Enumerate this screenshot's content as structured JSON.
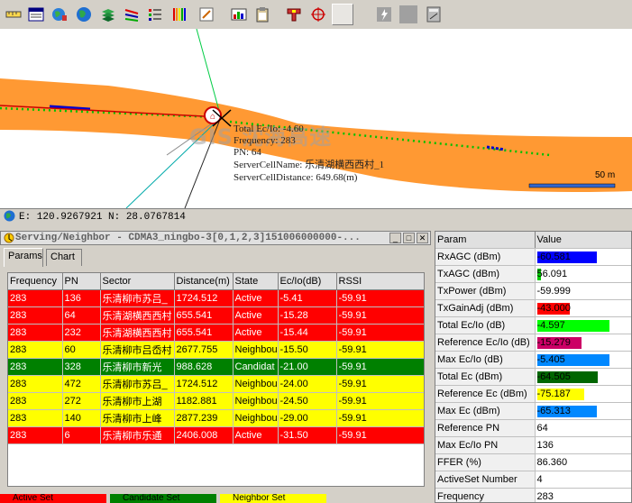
{
  "toolbar": {
    "icons": [
      "ruler-icon",
      "table-view-icon",
      "globe-tool-icon",
      "globe-icon",
      "layers-icon",
      "legend-icon",
      "list-icon",
      "color-bars-icon",
      "edit-icon",
      "chart-icon",
      "clipboard-icon",
      "measure-icon",
      "target-icon",
      "blank-button",
      "lightning-icon",
      "gray-button",
      "calc-icon"
    ]
  },
  "map": {
    "labels": {
      "total_ecio": "Total Ec/Io: -4.60",
      "frequency": "Frequency: 283",
      "pn": "PN: 64",
      "server_cell_name": "ServerCellName: 乐清湖横西西村_1",
      "server_cell_distance": "ServerCellDistance: 649.68(m)"
    },
    "watermark": "GIS 沈海高速",
    "scale": "50 m",
    "colors": {
      "road": "#ff9933",
      "track": "#00cc00"
    }
  },
  "coord_bar": {
    "text": "E: 120.9267921 N: 28.0767814"
  },
  "panel": {
    "title": "Serving/Neighbor - CDMA3_ningbo-3[0,1,2,3]151006000000-...",
    "tabs": [
      "Params",
      "Chart"
    ],
    "columns": [
      "Frequency",
      "PN",
      "Sector",
      "Distance(m)",
      "State",
      "Ec/Io(dB)",
      "RSSI"
    ],
    "rows": [
      {
        "color": "red",
        "cells": [
          "283",
          "136",
          "乐清柳市苏吕_",
          "1724.512",
          "Active",
          "-5.41",
          "-59.91"
        ]
      },
      {
        "color": "red",
        "cells": [
          "283",
          "64",
          "乐清湖横西西村",
          "655.541",
          "Active",
          "-15.28",
          "-59.91"
        ]
      },
      {
        "color": "red",
        "cells": [
          "283",
          "232",
          "乐清湖横西西村",
          "655.541",
          "Active",
          "-15.44",
          "-59.91"
        ]
      },
      {
        "color": "yellow",
        "cells": [
          "283",
          "60",
          "乐清柳市吕岙村",
          "2677.755",
          "Neighbou",
          "-15.50",
          "-59.91"
        ]
      },
      {
        "color": "green",
        "cells": [
          "283",
          "328",
          "乐清柳市新光",
          "988.628",
          "Candidat",
          "-21.00",
          "-59.91"
        ]
      },
      {
        "color": "yellow",
        "cells": [
          "283",
          "472",
          "乐清柳市苏吕_",
          "1724.512",
          "Neighbou",
          "-24.00",
          "-59.91"
        ]
      },
      {
        "color": "yellow",
        "cells": [
          "283",
          "272",
          "乐清柳市上湖",
          "1182.881",
          "Neighbou",
          "-24.50",
          "-59.91"
        ]
      },
      {
        "color": "yellow",
        "cells": [
          "283",
          "140",
          "乐清柳市上峰",
          "2877.239",
          "Neighbou",
          "-29.00",
          "-59.91"
        ]
      },
      {
        "color": "red",
        "cells": [
          "283",
          "6",
          "乐清柳市乐通",
          "2406.008",
          "Active",
          "-31.50",
          "-59.91"
        ]
      }
    ],
    "legend": [
      "Active Set",
      "Candidate Set",
      "Neighbor Set"
    ]
  },
  "params": {
    "columns": [
      "Param",
      "Value"
    ],
    "rows": [
      {
        "label": "RxAGC (dBm)",
        "value": "-60.581",
        "bar_color": "#0000ff",
        "bar_fraction": 0.95
      },
      {
        "label": "TxAGC (dBm)",
        "value": "56.091",
        "bar_color": "#00cc00",
        "bar_fraction": 0.06
      },
      {
        "label": "TxPower (dBm)",
        "value": "-59.999",
        "bar_color": "",
        "bar_fraction": 0
      },
      {
        "label": "TxGainAdj (dBm)",
        "value": "-43.000",
        "bar_color": "#ff0000",
        "bar_fraction": 0.52
      },
      {
        "label": "Total Ec/Io (dB)",
        "value": "-4.597",
        "bar_color": "#00ff00",
        "bar_fraction": 1.15
      },
      {
        "label": "Reference Ec/Io (dB)",
        "value": "-15.279",
        "bar_color": "#cc0066",
        "bar_fraction": 0.7
      },
      {
        "label": "Max Ec/Io (dB)",
        "value": "-5.405",
        "bar_color": "#0088ff",
        "bar_fraction": 1.15
      },
      {
        "label": "Total Ec (dBm)",
        "value": "-64.505",
        "bar_color": "#006600",
        "bar_fraction": 0.97
      },
      {
        "label": "Reference Ec (dBm)",
        "value": "-75.187",
        "bar_color": "#ffff00",
        "bar_fraction": 0.75
      },
      {
        "label": "Max Ec (dBm)",
        "value": "-65.313",
        "bar_color": "#0088ff",
        "bar_fraction": 0.95
      },
      {
        "label": "Reference PN",
        "value": "64",
        "bar_color": "",
        "bar_fraction": 0
      },
      {
        "label": "Max Ec/Io PN",
        "value": "136",
        "bar_color": "",
        "bar_fraction": 0
      },
      {
        "label": "FFER (%)",
        "value": "86.360",
        "bar_color": "",
        "bar_fraction": 0
      },
      {
        "label": "ActiveSet Number",
        "value": "4",
        "bar_color": "",
        "bar_fraction": 0
      },
      {
        "label": "Frequency",
        "value": "283",
        "bar_color": "",
        "bar_fraction": 0
      }
    ]
  }
}
